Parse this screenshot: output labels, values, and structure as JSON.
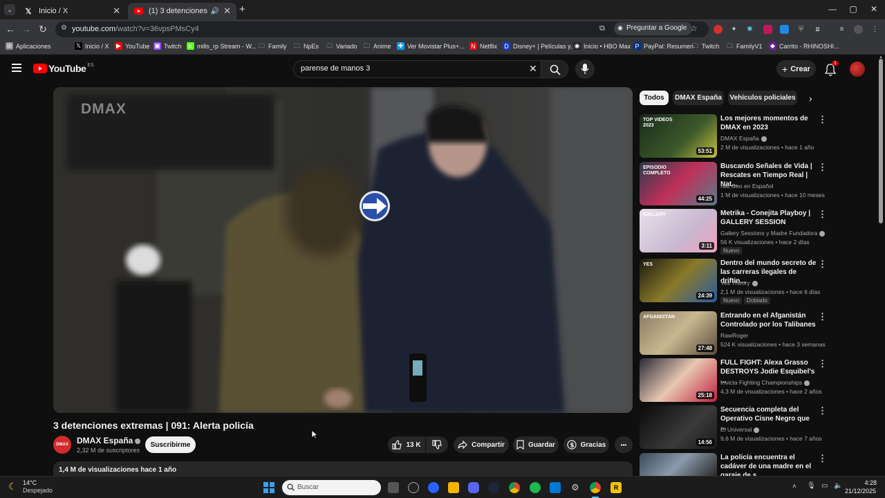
{
  "browser": {
    "tabs": [
      {
        "title": "Inicio / X",
        "icon": "x-icon"
      },
      {
        "title": "(1) 3 detenciones extremas",
        "icon": "youtube-icon"
      }
    ],
    "new_tab": "+",
    "window_controls": [
      "—",
      "▢",
      "✕"
    ],
    "url_host": "youtube.com",
    "url_path": "/watch?v=36vpsPMsCy4",
    "ask_google": "Preguntar a Google",
    "bookmarks": [
      {
        "label": "Aplicaciones",
        "icon": "apps-icon"
      },
      {
        "label": "Inicio / X",
        "icon": "x-icon"
      },
      {
        "label": "YouTube",
        "icon": "youtube-icon"
      },
      {
        "label": "Twitch",
        "icon": "twitch-icon"
      },
      {
        "label": "mills_rp Stream - W...",
        "icon": "kick-icon"
      },
      {
        "label": "Family",
        "icon": "folder-icon"
      },
      {
        "label": "NpEs",
        "icon": "folder-icon"
      },
      {
        "label": "Variado",
        "icon": "folder-icon"
      },
      {
        "label": "Anime",
        "icon": "folder-icon"
      },
      {
        "label": "Ver Movistar Plus+...",
        "icon": "movistar-icon"
      },
      {
        "label": "Netflix",
        "icon": "netflix-icon"
      },
      {
        "label": "Disney+ | Películas y...",
        "icon": "disney-icon"
      },
      {
        "label": "Inicio • HBO Max",
        "icon": "hbo-icon"
      },
      {
        "label": "PayPal: Resumen",
        "icon": "paypal-icon"
      },
      {
        "label": "Twitch",
        "icon": "folder-icon"
      },
      {
        "label": "FamilyV1",
        "icon": "folder-icon"
      },
      {
        "label": "Carrito - RHINOSHI...",
        "icon": "rhino-icon"
      }
    ]
  },
  "youtube": {
    "logo_text": "YouTube",
    "logo_region": "ES",
    "search_query": "parense de manos 3",
    "create_label": "Crear",
    "notif_count": "1",
    "video": {
      "watermark": "DMAX",
      "title": "3 detenciones extremas | 091: Alerta policía",
      "channel_avatar_text": "DMAX",
      "channel": "DMAX España",
      "subscribers": "2,32 M de suscriptores",
      "subscribe_label": "Suscribirme",
      "likes": "13 K",
      "share_label": "Compartir",
      "save_label": "Guardar",
      "thanks_label": "Gracias",
      "more": "•••",
      "views_line": "1,4 M de visualizaciones  hace 1 año"
    },
    "chips": [
      "Todos",
      "DMAX España",
      "Vehículos policiales"
    ],
    "recommendations": [
      {
        "title": "Los mejores momentos de DMAX en 2023",
        "channel": "DMAX España",
        "verified": true,
        "meta": "2 M de visualizaciones • hace 1 año",
        "duration": "53:51",
        "thumb_text": "TOP VIDEOS 2023",
        "badges": []
      },
      {
        "title": "Buscando Señales de Vida | Rescates en Tiempo Real | Nat...",
        "channel": "Nat Geo en Español",
        "verified": false,
        "meta": "1 M de visualizaciones • hace 10 meses",
        "duration": "44:25",
        "thumb_text": "EPISODIO COMPLETO",
        "badges": []
      },
      {
        "title": "Metrika - Conejita Playboy | GALLERY SESSION",
        "channel": "Gallery Sessions  y Madre Fundadora",
        "verified": true,
        "meta": "56 K visualizaciones • hace 2 días",
        "duration": "3:11",
        "thumb_text": "GALLERY",
        "badges": [
          "Nuevo"
        ]
      },
      {
        "title": "Dentro del mundo secreto de las carreras ilegales de driftin...",
        "channel": "Yes Theory",
        "verified": true,
        "meta": "2,1 M de visualizaciones • hace 6 días",
        "duration": "24:39",
        "thumb_text": "YES",
        "badges": [
          "Nuevo",
          "Doblado"
        ]
      },
      {
        "title": "Entrando en el Afganistán Controlado por los Talibanes",
        "channel": "RawRoger",
        "verified": false,
        "meta": "524 K visualizaciones • hace 3 semanas",
        "duration": "27:48",
        "thumb_text": "AFGANISTÁN",
        "badges": []
      },
      {
        "title": "FULL FIGHT: Alexa Grasso DESTROYS Jodie Esquibel's ...",
        "channel": "Invicta Fighting Championships",
        "verified": true,
        "meta": "4,3 M de visualizaciones • hace 2 años",
        "duration": "25:18",
        "thumb_text": "",
        "badges": []
      },
      {
        "title": "Secuencia completa del Operativo Cisne Negro que ...",
        "channel": "El Universal",
        "verified": true,
        "meta": "9,6 M de visualizaciones • hace 7 años",
        "duration": "14:56",
        "thumb_text": "",
        "badges": []
      },
      {
        "title": "La policía encuentra el cadáver de una madre en el garaje de s...",
        "channel": "",
        "verified": false,
        "meta": "",
        "duration": "",
        "thumb_text": "",
        "badges": []
      }
    ],
    "colors": {
      "bg": "#0f0f0f",
      "surface": "#272727",
      "brand_red": "#ff0000"
    }
  },
  "taskbar": {
    "weather_temp": "14°C",
    "weather_desc": "Despejado",
    "search_placeholder": "Buscar",
    "time": "4:28",
    "date": "21/12/2025"
  }
}
